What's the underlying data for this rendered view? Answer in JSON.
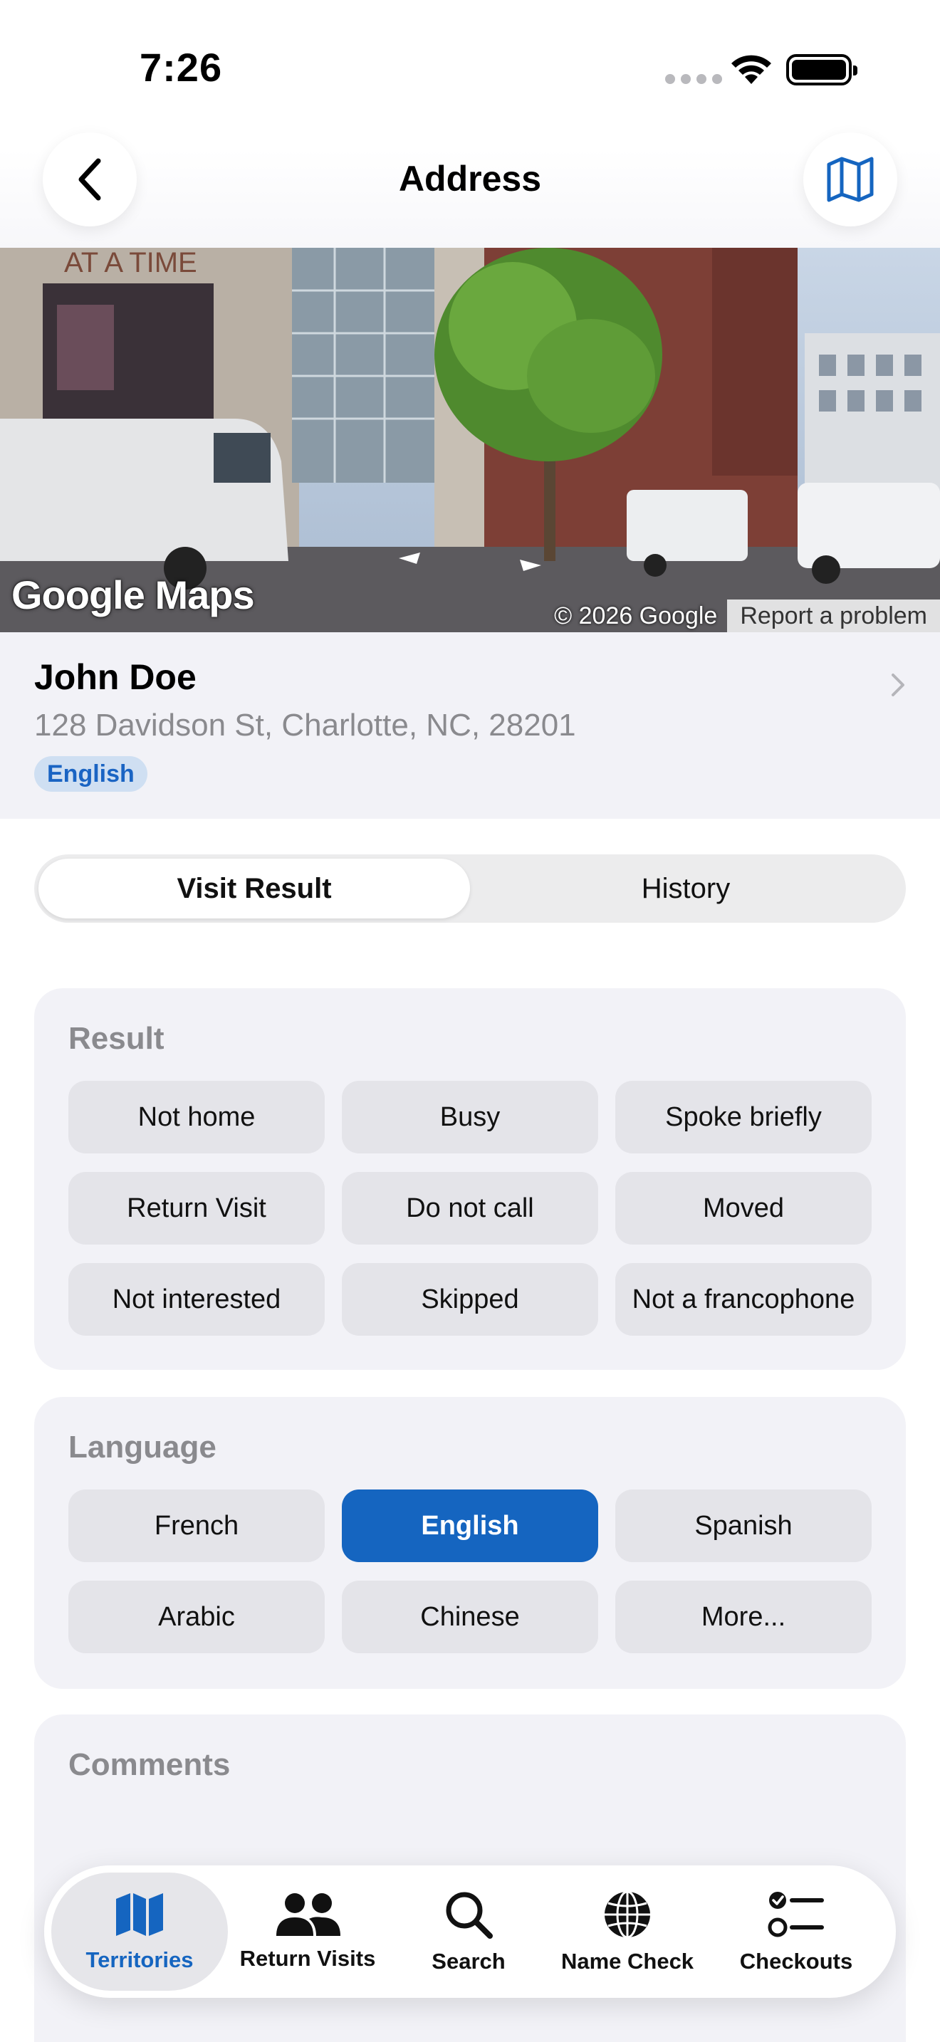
{
  "status_bar": {
    "time": "7:26"
  },
  "header": {
    "title": "Address"
  },
  "street_view": {
    "logo": "Google Maps",
    "copyright": "© 2026 Google",
    "report": "Report a problem",
    "sign_text": "AT A TIME"
  },
  "contact": {
    "name": "John Doe",
    "address": "128 Davidson St, Charlotte, NC, 28201",
    "language_badge": "English"
  },
  "tabs_segment": [
    {
      "label": "Visit Result",
      "active": true
    },
    {
      "label": "History",
      "active": false
    }
  ],
  "result": {
    "title": "Result",
    "options": [
      "Not home",
      "Busy",
      "Spoke briefly",
      "Return Visit",
      "Do not call",
      "Moved",
      "Not interested",
      "Skipped",
      "Not a francophone"
    ]
  },
  "language": {
    "title": "Language",
    "options": [
      "French",
      "English",
      "Spanish",
      "Arabic",
      "Chinese",
      "More..."
    ],
    "selected": "English"
  },
  "comments": {
    "title": "Comments"
  },
  "tab_bar": {
    "items": [
      {
        "label": "Territories",
        "icon": "map-icon",
        "active": true
      },
      {
        "label": "Return Visits",
        "icon": "people-icon",
        "active": false
      },
      {
        "label": "Search",
        "icon": "search-icon",
        "active": false
      },
      {
        "label": "Name Check",
        "icon": "globe-icon",
        "active": false
      },
      {
        "label": "Checkouts",
        "icon": "checklist-icon",
        "active": false
      }
    ]
  },
  "colors": {
    "accent": "#1565c0",
    "badge_bg": "#cfdff2",
    "card_bg": "#f2f2f7"
  }
}
